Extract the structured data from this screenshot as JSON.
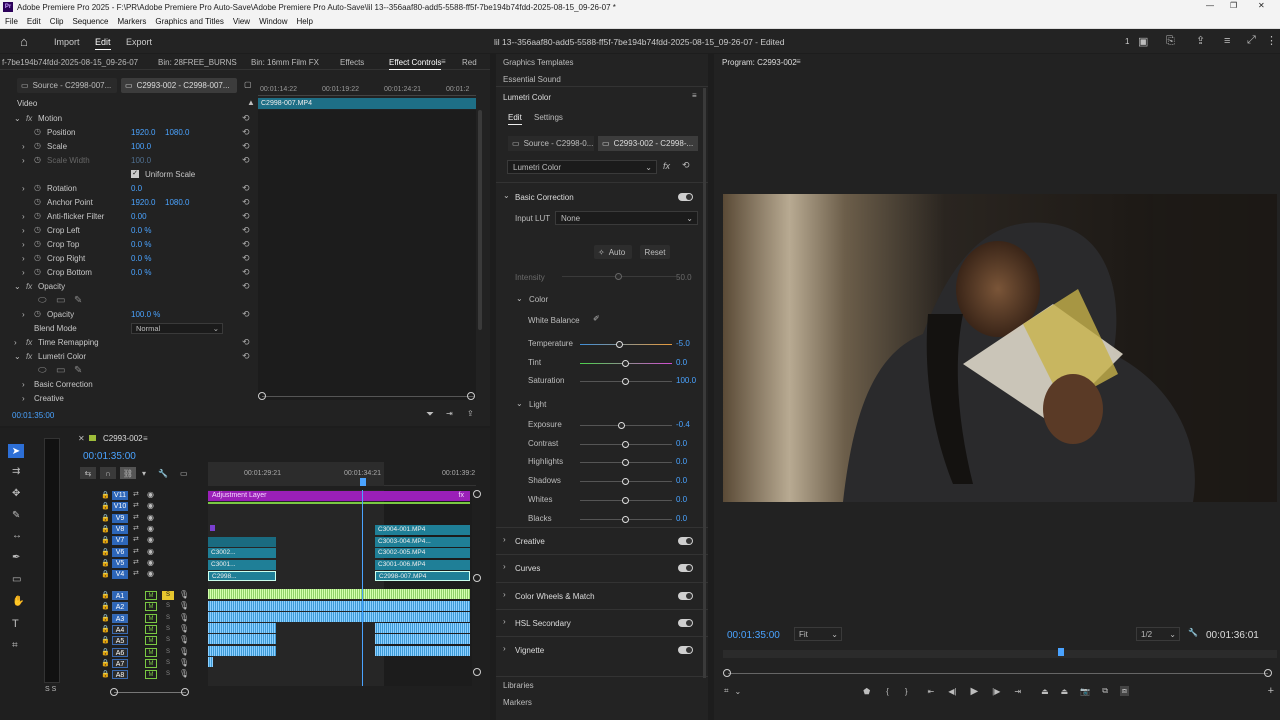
{
  "window": {
    "title": "Adobe Premiere Pro 2025 - F:\\PR\\Adobe Premiere Pro Auto-Save\\Adobe Premiere Pro Auto-Save\\lil 13--356aaf80-add5-5588-ff5f-7be194b74fdd-2025-08-15_09-26-07 *",
    "app_icon": "Pr"
  },
  "menu": [
    "File",
    "Edit",
    "Clip",
    "Sequence",
    "Markers",
    "Graphics and Titles",
    "View",
    "Window",
    "Help"
  ],
  "topbar": {
    "tabs": [
      "Import",
      "Edit",
      "Export"
    ],
    "active_tab": "Edit",
    "project_title": "lil 13--356aaf80-add5-5588-ff5f-7be194b74fdd-2025-08-15_09-26-07 - Edited",
    "page_num": "1"
  },
  "source_panel": {
    "tabs": [
      "f-7be194b74fdd-2025-08-15_09-26-07",
      "Bin: 28FREE_BURNS",
      "Bin: 16mm Film FX",
      "Effects",
      "Effect Controls",
      "Red"
    ],
    "active_tab": "Effect Controls",
    "source_chip": "Source - C2998-007...",
    "seq_chip": "C2993-002 - C2998-007...",
    "ruler": [
      "00:01:14:22",
      "00:01:19:22",
      "00:01:24:21",
      "00:01:2"
    ],
    "clip_name": "C2998-007.MP4",
    "section": "Video",
    "timecode": "00:01:35:00"
  },
  "effect_props": [
    {
      "label": "Motion",
      "indent": 0,
      "fx": true,
      "expand": "open"
    },
    {
      "label": "Position",
      "indent": 1,
      "v1": "1920.0",
      "v2": "1080.0",
      "kf": true
    },
    {
      "label": "Scale",
      "indent": 1,
      "v1": "100.0",
      "kf": true,
      "expand": "closed"
    },
    {
      "label": "Scale Width",
      "indent": 1,
      "v1": "100.0",
      "kf": true,
      "dim": true,
      "expand": "closed"
    },
    {
      "label": "Uniform Scale",
      "indent": 2,
      "check": true
    },
    {
      "label": "Rotation",
      "indent": 1,
      "v1": "0.0",
      "kf": true,
      "expand": "closed"
    },
    {
      "label": "Anchor Point",
      "indent": 1,
      "v1": "1920.0",
      "v2": "1080.0",
      "kf": true
    },
    {
      "label": "Anti-flicker Filter",
      "indent": 1,
      "v1": "0.00",
      "kf": true,
      "expand": "closed"
    },
    {
      "label": "Crop Left",
      "indent": 1,
      "v1": "0.0 %",
      "kf": true,
      "expand": "closed"
    },
    {
      "label": "Crop Top",
      "indent": 1,
      "v1": "0.0 %",
      "kf": true,
      "expand": "closed"
    },
    {
      "label": "Crop Right",
      "indent": 1,
      "v1": "0.0 %",
      "kf": true,
      "expand": "closed"
    },
    {
      "label": "Crop Bottom",
      "indent": 1,
      "v1": "0.0 %",
      "kf": true,
      "expand": "closed"
    },
    {
      "label": "Opacity",
      "indent": 0,
      "fx": true,
      "expand": "open"
    },
    {
      "label": "",
      "indent": 1,
      "masks": true
    },
    {
      "label": "Opacity",
      "indent": 1,
      "v1": "100.0 %",
      "kf": true,
      "expand": "closed"
    },
    {
      "label": "Blend Mode",
      "indent": 1,
      "select": "Normal"
    },
    {
      "label": "Time Remapping",
      "indent": 0,
      "fx": true,
      "expand": "closed"
    },
    {
      "label": "Lumetri Color",
      "indent": 0,
      "fx": true,
      "expand": "open"
    },
    {
      "label": "",
      "indent": 1,
      "masks": true
    },
    {
      "label": "Basic Correction",
      "indent": 1,
      "expand": "closed"
    },
    {
      "label": "Creative",
      "indent": 1,
      "expand": "closed"
    }
  ],
  "lumetri": {
    "side_tabs": [
      "Graphics Templates",
      "Essential Sound",
      "Lumetri Color"
    ],
    "tabs": [
      "Edit",
      "Settings"
    ],
    "source_chip": "Source - C2998-0...",
    "seq_chip": "C2993-002 - C2998-...",
    "effect_select": "Lumetri Color",
    "basic_correction": "Basic Correction",
    "input_lut_label": "Input LUT",
    "input_lut": "None",
    "auto": "Auto",
    "reset": "Reset",
    "intensity_label": "Intensity",
    "intensity": "50.0",
    "color_label": "Color",
    "white_balance": "White Balance",
    "light_label": "Light",
    "color_rows": [
      {
        "label": "Temperature",
        "value": "-5.0",
        "pos": 0.44
      },
      {
        "label": "Tint",
        "value": "0.0",
        "pos": 0.5
      },
      {
        "label": "Saturation",
        "value": "100.0",
        "pos": 0.5
      }
    ],
    "light_rows": [
      {
        "label": "Exposure",
        "value": "-0.4",
        "pos": 0.46
      },
      {
        "label": "Contrast",
        "value": "0.0",
        "pos": 0.5
      },
      {
        "label": "Highlights",
        "value": "0.0",
        "pos": 0.5
      },
      {
        "label": "Shadows",
        "value": "0.0",
        "pos": 0.5
      },
      {
        "label": "Whites",
        "value": "0.0",
        "pos": 0.5
      },
      {
        "label": "Blacks",
        "value": "0.0",
        "pos": 0.5
      }
    ],
    "sections": [
      "Creative",
      "Curves",
      "Color Wheels & Match",
      "HSL Secondary",
      "Vignette"
    ],
    "bottom": [
      "Libraries",
      "Markers"
    ]
  },
  "program": {
    "title": "Program: C2993-002",
    "timecode": "00:01:35:00",
    "fit": "Fit",
    "resolution": "1/2",
    "duration": "00:01:36:01",
    "playhead": 0.61
  },
  "timeline": {
    "seq_name": "C2993-002",
    "timecode": "00:01:35:00",
    "ruler": [
      "00:01:29:21",
      "00:01:34:21",
      "00:01:39:2"
    ],
    "video_tracks": [
      "V11",
      "V10",
      "V9",
      "V8",
      "V7",
      "V6",
      "V5",
      "V4"
    ],
    "audio_tracks": [
      "A1",
      "A2",
      "A3",
      "A4",
      "A5",
      "A6",
      "A7",
      "A8"
    ],
    "adjustment_layer": "Adjustment Layer",
    "clips_right": [
      "C3004-001.MP4",
      "C3003-004.MP4...",
      "C3002-005.MP4",
      "C3001-006.MP4",
      "C2998-007.MP4"
    ],
    "clips_left": [
      "C3002...",
      "C3001...",
      "C2998..."
    ]
  },
  "colors": {
    "accent": "#2d8ceb",
    "adjustment": "#9a1fb8",
    "clip": "#1f7f97",
    "audio": "#3d9bd6",
    "audio_hi": "#9be07a"
  }
}
